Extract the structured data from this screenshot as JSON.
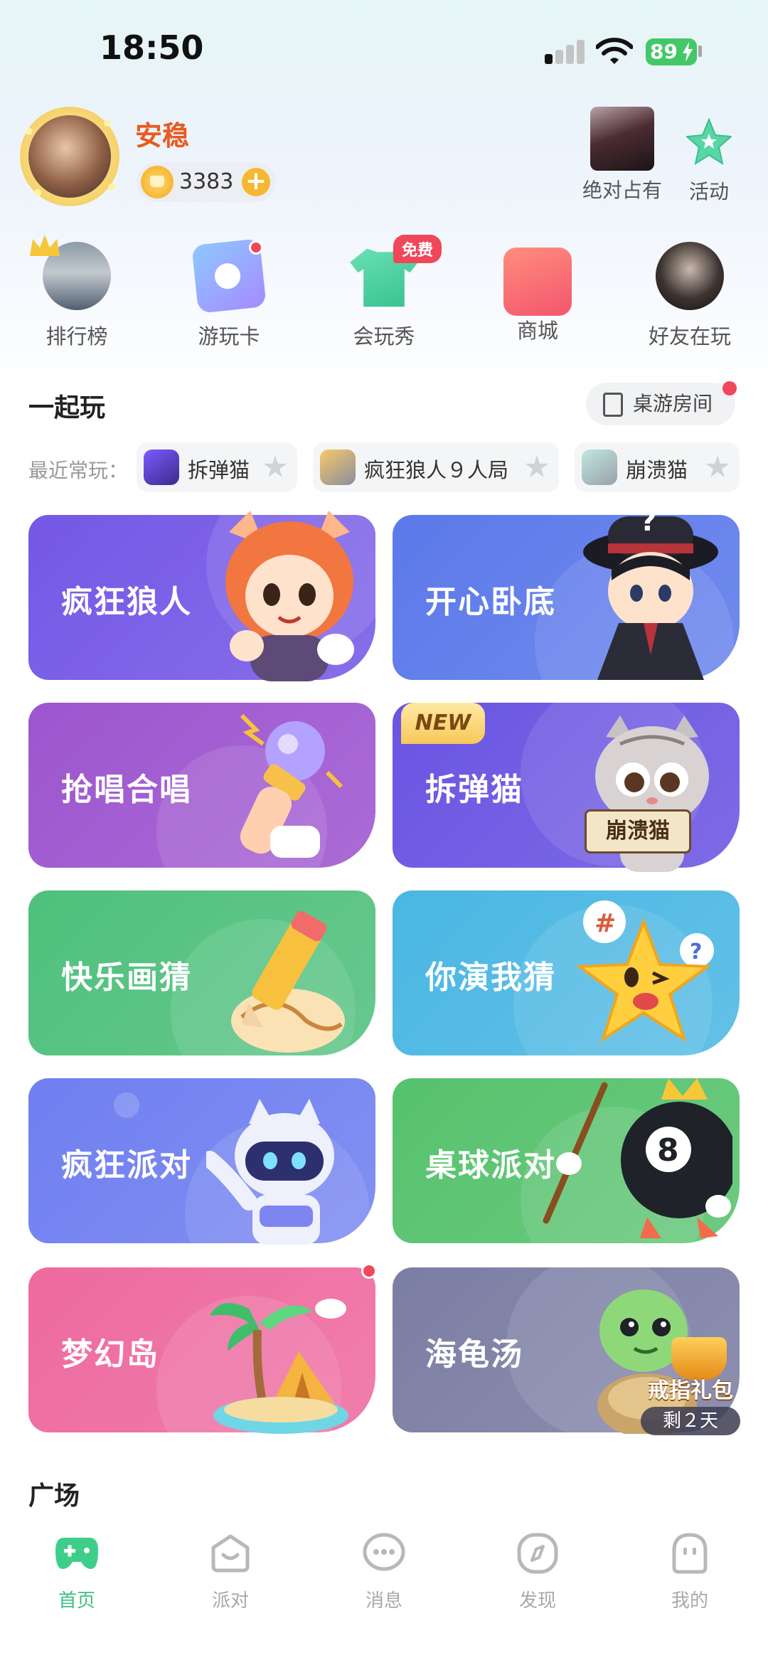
{
  "status_bar": {
    "time": "18:50",
    "battery": "89"
  },
  "profile": {
    "name": "安稳",
    "coins": "3383",
    "coin_add": "+"
  },
  "header_actions": [
    {
      "label": "绝对占有"
    },
    {
      "label": "活动"
    }
  ],
  "quick_entries": [
    {
      "label": "排行榜"
    },
    {
      "label": "游玩卡"
    },
    {
      "label": "会玩秀",
      "badge": "免费"
    },
    {
      "label": "商城"
    },
    {
      "label": "好友在玩"
    }
  ],
  "play_section": {
    "title": "一起玩",
    "room_button": "桌游房间",
    "recent_label": "最近常玩：",
    "recent": [
      {
        "name": "拆弹猫"
      },
      {
        "name": "疯狂狼人９人局"
      },
      {
        "name": "崩溃猫"
      }
    ]
  },
  "games": [
    {
      "title": "疯狂狼人",
      "color": "#7458e6"
    },
    {
      "title": "开心卧底",
      "color": "#5b79ea"
    },
    {
      "title": "抢唱合唱",
      "color": "#9d55cf"
    },
    {
      "title": "拆弹猫",
      "color": "#6a54e2",
      "badge": "NEW",
      "sign": "崩溃猫"
    },
    {
      "title": "快乐画猜",
      "color": "#4fc07c"
    },
    {
      "title": "你演我猜",
      "color": "#4ab7e3"
    },
    {
      "title": "疯狂派对",
      "color": "#6f7ff0"
    },
    {
      "title": "桌球派对",
      "color": "#56c26d"
    },
    {
      "title": "梦幻岛",
      "color": "#ee6a9f"
    },
    {
      "title": "海龟汤",
      "color": "#7b7ea3",
      "gift_title": "戒指礼包",
      "gift_days": "剩２天"
    }
  ],
  "plaza": {
    "title": "广场"
  },
  "bottom_nav": [
    {
      "label": "首页",
      "active": true
    },
    {
      "label": "派对"
    },
    {
      "label": "消息"
    },
    {
      "label": "发现"
    },
    {
      "label": "我的"
    }
  ],
  "colors": {
    "accent": "#3dbf7f",
    "badge_red": "#f0475a",
    "username": "#e85a1f"
  }
}
